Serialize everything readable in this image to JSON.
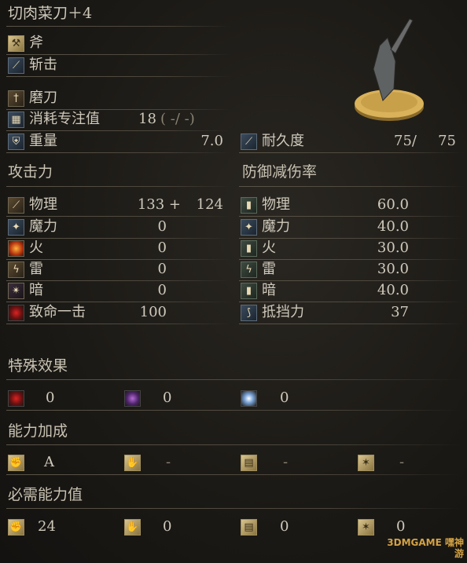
{
  "weapon": {
    "name": "切肉菜刀＋4",
    "weapon_type": "斧",
    "attack_type": "斩击",
    "skill": "磨刀",
    "fp_cost_label": "消耗专注值",
    "fp_cost_value": "18",
    "fp_cost_detail": "( -/ -)",
    "weight_label": "重量",
    "weight_value": "7.0",
    "durability_label": "耐久度",
    "durability_value": "75/",
    "durability_max": "75"
  },
  "attack": {
    "title": "攻击力",
    "rows": [
      {
        "label": "物理",
        "value": "133 +",
        "extra": "124",
        "icon": "physical-icon"
      },
      {
        "label": "魔力",
        "value": "0",
        "icon": "magic-icon"
      },
      {
        "label": "火",
        "value": "0",
        "icon": "fire-icon"
      },
      {
        "label": "雷",
        "value": "0",
        "icon": "lightning-icon"
      },
      {
        "label": "暗",
        "value": "0",
        "icon": "dark-icon"
      },
      {
        "label": "致命一击",
        "value": "100",
        "icon": "critical-icon"
      }
    ]
  },
  "defense": {
    "title": "防御减伤率",
    "rows": [
      {
        "label": "物理",
        "value": "60.0",
        "icon": "physical-defense-icon"
      },
      {
        "label": "魔力",
        "value": "40.0",
        "icon": "magic-defense-icon"
      },
      {
        "label": "火",
        "value": "30.0",
        "icon": "fire-defense-icon"
      },
      {
        "label": "雷",
        "value": "30.0",
        "icon": "lightning-defense-icon"
      },
      {
        "label": "暗",
        "value": "40.0",
        "icon": "dark-defense-icon"
      },
      {
        "label": "抵挡力",
        "value": "37",
        "icon": "stability-icon"
      }
    ]
  },
  "special": {
    "title": "特殊效果",
    "values": [
      "0",
      "0",
      "0"
    ]
  },
  "scaling": {
    "title": "能力加成",
    "values": [
      "A",
      "-",
      "-",
      "-"
    ]
  },
  "requirements": {
    "title": "必需能力值",
    "values": [
      "24",
      "0",
      "0",
      "0"
    ]
  },
  "watermark": "3DMGAME 嘿神游"
}
